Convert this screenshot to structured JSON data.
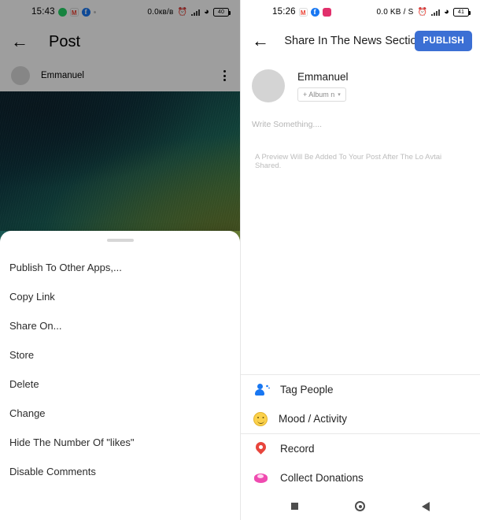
{
  "left_screen": {
    "status_bar": {
      "time": "15:43",
      "app_icons": [
        "whatsapp-icon",
        "gmail-icon",
        "facebook-icon"
      ],
      "network_speed": "0.0кв/в",
      "battery_level": "40",
      "icons": [
        "alarm-icon",
        "signal-icon",
        "wifi-icon",
        "battery-icon"
      ]
    },
    "app_bar": {
      "back_label": "←",
      "title": "Post"
    },
    "author_row": {
      "name": "Emmanuel",
      "menu_label": "⋮"
    },
    "sheet": {
      "items": [
        {
          "label": "Publish To Other Apps,..."
        },
        {
          "label": "Copy Link"
        },
        {
          "label": "Share On..."
        },
        {
          "label": "Store"
        },
        {
          "label": "Delete"
        },
        {
          "label": "Change"
        },
        {
          "label": "Hide The Number Of \"likes\""
        },
        {
          "label": "Disable Comments"
        }
      ]
    },
    "nav_bar": {
      "recents": "recents-icon",
      "home": "home-icon",
      "back": "back-icon"
    }
  },
  "right_screen": {
    "status_bar": {
      "time": "15:26",
      "app_icons": [
        "gmail-icon",
        "facebook-icon",
        "instagram-icon"
      ],
      "network_speed": "0.0 KB / S",
      "battery_level": "41",
      "icons": [
        "alarm-icon",
        "signal-icon",
        "wifi-icon",
        "battery-icon"
      ]
    },
    "app_bar": {
      "back_label": "←",
      "title": "Share In The News Section -",
      "publish_label": "PUBLISH",
      "publish_color": "#3b6fd4"
    },
    "composer": {
      "user_name": "Emmanuel",
      "album_chip": "+ Album n",
      "album_caret": "▾",
      "write_placeholder": "Write Something....",
      "preview_note": "A Preview Will Be Added To Your Post After The Lo Avtai Shared."
    },
    "actions": [
      {
        "label": "Tag People",
        "icon": "tag-people-icon",
        "color": "#1877f2"
      },
      {
        "label": "Mood / Activity",
        "icon": "mood-icon",
        "color": "#fbd14b"
      },
      {
        "label": "Record",
        "icon": "location-pin-icon",
        "color": "#e8453c"
      },
      {
        "label": "Collect Donations",
        "icon": "donation-icon",
        "color": "#ef4bb0"
      }
    ],
    "nav_bar": {
      "recents": "recents-icon",
      "home": "home-icon",
      "back": "back-icon"
    }
  }
}
